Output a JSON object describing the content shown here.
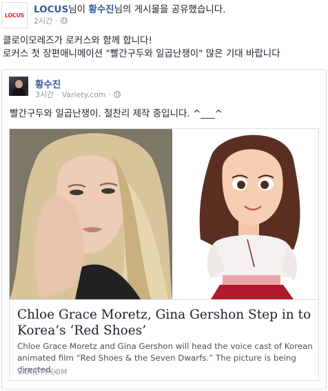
{
  "header": {
    "page_name": "LOCUS",
    "mid1": "님이 ",
    "person_name": "황수진",
    "mid2": "님의 게시물을 공유했습니다.",
    "time": "2시간",
    "logo_text": "LOCUS",
    "logo_color": "#d6262b",
    "privacy_icon": "globe-icon"
  },
  "post": {
    "line1": "클로이모레즈가 로커스와 함께 합니다!",
    "line2": "로커스 첫 장편애니메이션 \"빨간구두와 일곱난쟁이\" 많은 기대 바랍니다"
  },
  "shared_post": {
    "author": "황수진",
    "time": "3시간",
    "source": "Variety.com",
    "text": "빨간구두와 일곱난쟁이. 절찬리 제작 중입니다. ^___^",
    "link": {
      "title": "Chloe Grace Moretz, Gina Gershon Step in to Korea’s ‘Red Shoes’",
      "description": "Chloe Grace Moretz and Gina Gershon will head the voice cast of Korean animated film “Red Shoes & the Seven Dwarfs.” The picture is being directed…",
      "domain": "VARIETY.COM"
    }
  },
  "colors": {
    "link_blue": "#365899",
    "meta_gray": "#90949c",
    "border": "#dddfe2"
  }
}
